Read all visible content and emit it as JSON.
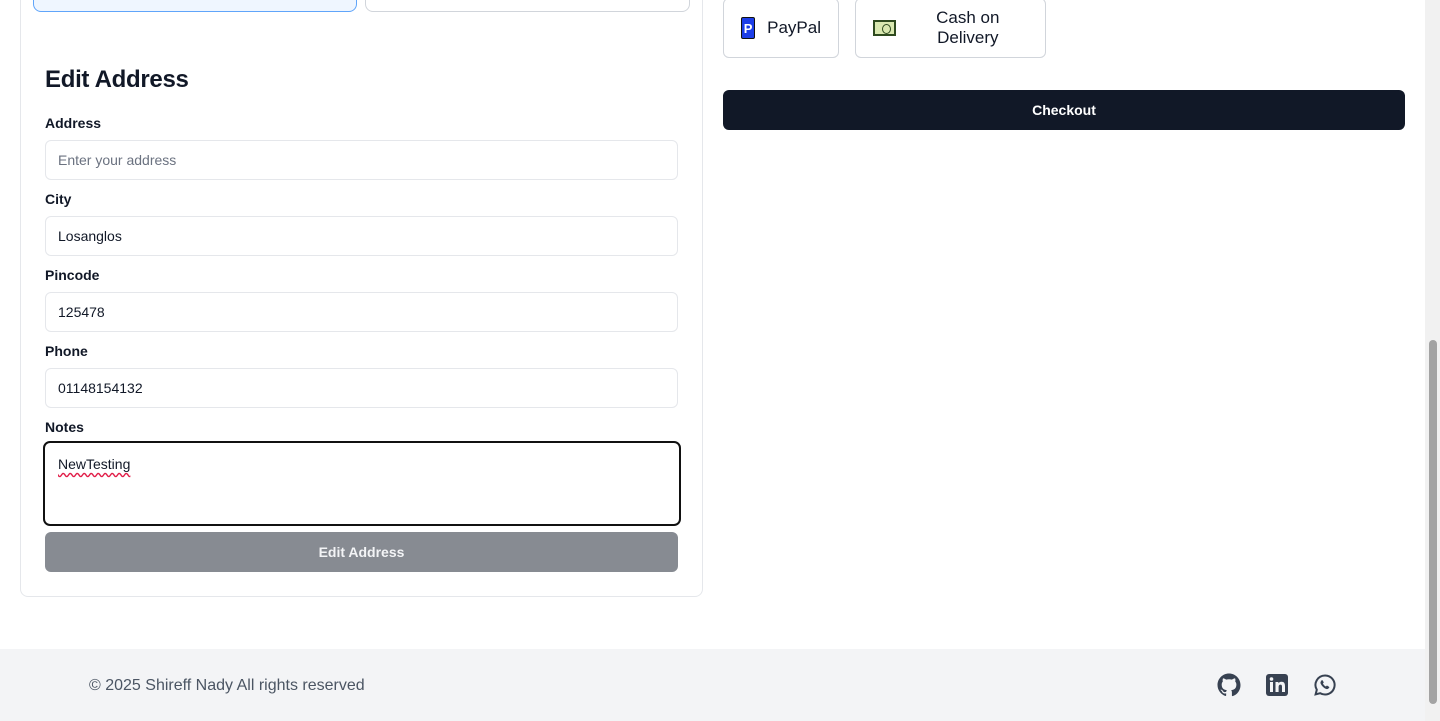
{
  "edit_address": {
    "title": "Edit Address",
    "address": {
      "label": "Address",
      "value": "",
      "placeholder": "Enter your address"
    },
    "city": {
      "label": "City",
      "value": "Losanglos"
    },
    "pincode": {
      "label": "Pincode",
      "value": "125478"
    },
    "phone": {
      "label": "Phone",
      "value": "01148154132"
    },
    "notes": {
      "label": "Notes",
      "value": "NewTesting"
    },
    "submit_label": "Edit Address"
  },
  "payment": {
    "methods": [
      {
        "label": "PayPal",
        "icon": "paypal-icon"
      },
      {
        "label": "Cash on Delivery",
        "icon": "cash-icon"
      }
    ],
    "checkout_label": "Checkout"
  },
  "footer": {
    "copyright": "© 2025 Shireff Nady All rights reserved",
    "social_icons": [
      "github-icon",
      "linkedin-icon",
      "whatsapp-icon"
    ]
  },
  "colors": {
    "primary": "#111827",
    "disabled_button": "#878b92",
    "footer_bg": "#f3f4f6",
    "paypal_blue": "#1d3ee8"
  }
}
